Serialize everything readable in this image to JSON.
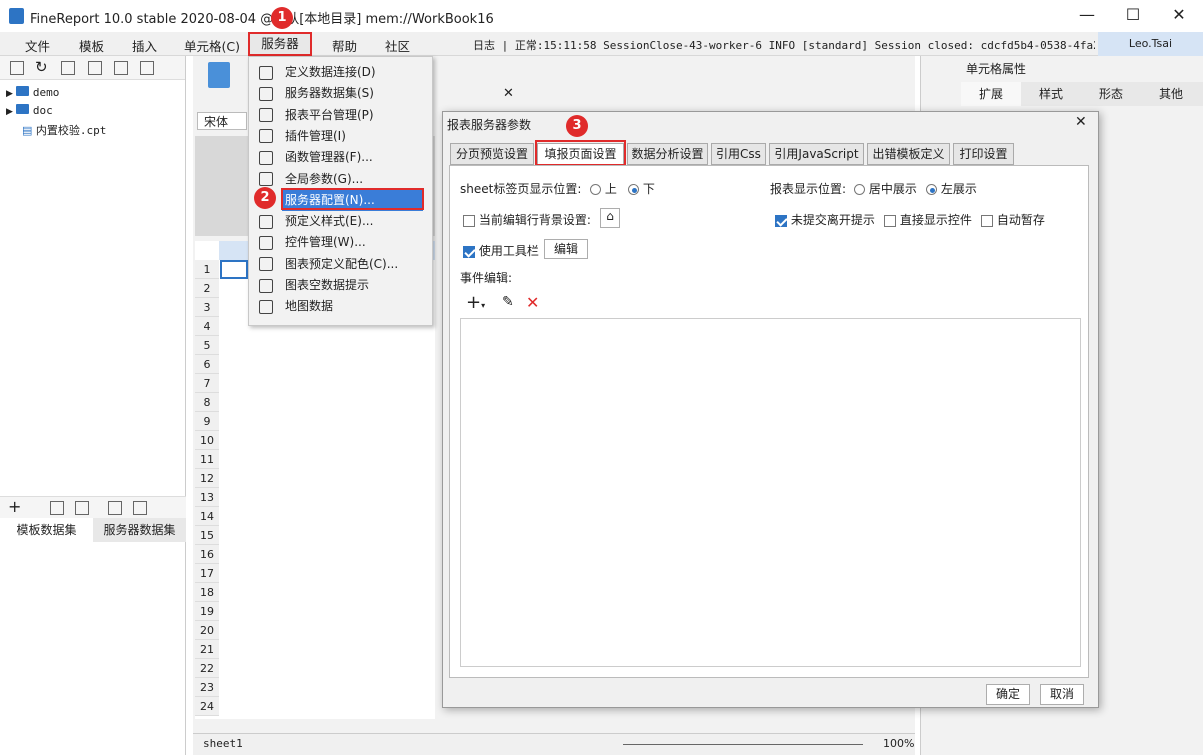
{
  "window": {
    "title": "FineReport 10.0 stable 2020-08-04 @默认[本地目录]    mem://WorkBook16",
    "min": "—",
    "max": "☐",
    "close": "✕"
  },
  "menu": {
    "items": [
      "文件",
      "模板",
      "插入",
      "单元格(C)",
      "服务器",
      "帮助",
      "社区"
    ],
    "log": "日志 | 正常:15:11:58 SessionClose-43-worker-6 INFO [standard] Session closed: cdcfd5b4-0538-4fa2-...",
    "user": "Leo.Tsai"
  },
  "left": {
    "tree": [
      "demo",
      "doc",
      "内置校验.cpt"
    ],
    "tabs": [
      "模板数据集",
      "服务器数据集"
    ]
  },
  "editor": {
    "font": "宋体",
    "tab_close": "✕",
    "rows": [
      "1",
      "2",
      "3",
      "4",
      "5",
      "6",
      "7",
      "8",
      "9",
      "10",
      "11",
      "12",
      "13",
      "14",
      "15",
      "16",
      "17",
      "18",
      "19",
      "20",
      "21",
      "22",
      "23",
      "24"
    ]
  },
  "server_menu": {
    "items": [
      "定义数据连接(D)",
      "服务器数据集(S)",
      "报表平台管理(P)",
      "插件管理(I)",
      "函数管理器(F)...",
      "全局参数(G)...",
      "服务器配置(N)...",
      "预定义样式(E)...",
      "控件管理(W)...",
      "图表预定义配色(C)...",
      "图表空数据提示",
      "地图数据"
    ],
    "icons": [
      "database-icon",
      "dataset-icon",
      "user-icon",
      "plugin-icon",
      "function-icon",
      "param-icon",
      "server-config-icon",
      "style-icon",
      "widget-icon",
      "chart-color-icon",
      "chart-empty-icon",
      "map-icon"
    ]
  },
  "badges": [
    "1",
    "2",
    "3"
  ],
  "dialog": {
    "title": "报表服务器参数",
    "close": "✕",
    "tabs": [
      "分页预览设置",
      "填报页面设置",
      "数据分析设置",
      "引用Css",
      "引用JavaScript",
      "出错模板定义",
      "打印设置"
    ],
    "sheet_pos_label": "sheet标签页显示位置:",
    "opt_top": "上",
    "opt_bottom": "下",
    "report_pos_label": "报表显示位置:",
    "opt_center": "居中展示",
    "opt_left": "左展示",
    "bg_label": "当前编辑行背景设置:",
    "unsubmit_label": "未提交离开提示",
    "direct_widget_label": "直接显示控件",
    "autosave_label": "自动暂存",
    "toolbar_label": "使用工具栏",
    "edit_btn": "编辑",
    "event_label": "事件编辑:",
    "ok": "确定",
    "cancel": "取消"
  },
  "right": {
    "title": "单元格属性",
    "tabs": [
      "扩展",
      "样式",
      "形态",
      "其他"
    ]
  },
  "sheetbar": {
    "sheet": "sheet1",
    "zoom": "100%"
  }
}
